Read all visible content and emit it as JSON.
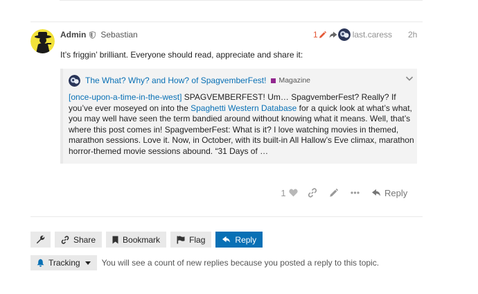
{
  "post": {
    "username": "Admin",
    "full_name": "Sebastian",
    "edit_count": "1",
    "reply_to_user": "last.caress",
    "date": "2h",
    "text": "It’s friggin’ brilliant. Everyone should read, appreciate and share it:",
    "like_count": "1",
    "reply_label": "Reply"
  },
  "quote": {
    "title": "The What? Why? and How? of SpagvemberFest!",
    "category": "Magazine",
    "category_color": "#92278f",
    "body_tag": "[once-upon-a-time-in-the-west]",
    "body_part1": " SPAGVEMBERFEST! Um… SpagvemberFest? Really? If you’ve ever moseyed on into the ",
    "body_link": "Spaghetti Western Database",
    "body_part2": " for a quick look at what’s what, you may well have seen the term bandied around without knowing what it means. Well, that’s where this post comes in! SpagvemberFest: What is it? I love watching movies in themed, marathon sessions. Love it. Now, in October, with its built-in All Hallow’s Eve climax, marathon horror-themed movie sessions abound. “31 Days of …"
  },
  "footer": {
    "share": "Share",
    "bookmark": "Bookmark",
    "flag": "Flag",
    "reply": "Reply"
  },
  "notifications": {
    "level": "Tracking",
    "description": "You will see a count of new replies because you posted a reply to this topic."
  },
  "colors": {
    "accent": "#0870b5",
    "edit_highlight": "#e45735",
    "button_bg": "#e9e9e9"
  },
  "icons": [
    "shield-icon",
    "pencil-icon",
    "reply-arrow-icon",
    "chevron-down-icon",
    "heart-icon",
    "link-icon",
    "ellipsis-icon",
    "wrench-icon",
    "bell-icon",
    "bookmark-icon",
    "flag-icon",
    "caret-down-icon"
  ]
}
